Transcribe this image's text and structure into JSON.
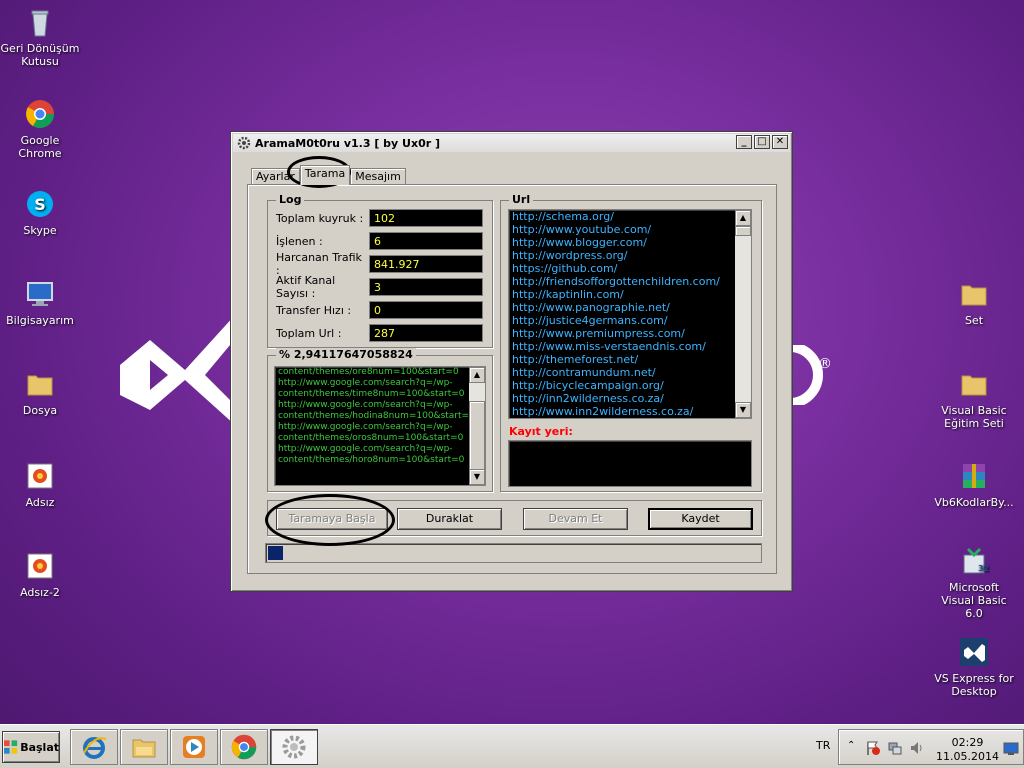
{
  "desktop": {
    "icons_left": [
      {
        "label": "Geri Dönüşüm Kutusu",
        "icon": "recycle-bin-icon"
      },
      {
        "label": "Google Chrome",
        "icon": "chrome-icon"
      },
      {
        "label": "Skype",
        "icon": "skype-icon"
      },
      {
        "label": "Bilgisayarım",
        "icon": "computer-icon"
      },
      {
        "label": "Dosya",
        "icon": "folder-icon"
      },
      {
        "label": "Adsız",
        "icon": "image-icon"
      },
      {
        "label": "Adsız-2",
        "icon": "image-icon"
      }
    ],
    "icons_right": [
      {
        "label": "Set",
        "icon": "folder-icon"
      },
      {
        "label": "Visual Basic Eğitim Seti",
        "icon": "folder-icon"
      },
      {
        "label": "Vb6KodlarBy...",
        "icon": "winrar-icon"
      },
      {
        "label": "Microsoft Visual Basic 6.0",
        "icon": "vb6-icon"
      },
      {
        "label": "VS Express for Desktop",
        "icon": "vs-icon"
      }
    ]
  },
  "window": {
    "title": "AramaM0t0ru v1.3 [ by Ux0r ]",
    "controls": {
      "minimize": "_",
      "maximize": "□",
      "close": "✕"
    },
    "tabs": [
      {
        "label": "Ayarlar",
        "active": false
      },
      {
        "label": "Tarama",
        "active": true
      },
      {
        "label": "Mesajım",
        "active": false
      }
    ],
    "log": {
      "title": "Log",
      "rows": [
        {
          "label": "Toplam kuyruk :",
          "value": "102"
        },
        {
          "label": "İşlenen :",
          "value": "6"
        },
        {
          "label": "Harcanan Trafik :",
          "value": "841.927"
        },
        {
          "label": "Aktif Kanal Sayısı :",
          "value": "3"
        },
        {
          "label": "Transfer Hızı :",
          "value": "0"
        },
        {
          "label": "Toplam Url :",
          "value": "287"
        }
      ]
    },
    "progress_group": {
      "title": "% 2,94117647058824",
      "lines": [
        "content/themes/ore8num=100&start=0",
        "http://www.google.com/search?q=/wp-",
        "content/themes/time8num=100&start=0",
        "http://www.google.com/search?q=/wp-",
        "content/themes/hodina8num=100&start=0",
        "http://www.google.com/search?q=/wp-",
        "content/themes/oros8num=100&start=0",
        "http://www.google.com/search?q=/wp-",
        "content/themes/horo8num=100&start=0"
      ]
    },
    "url_group": {
      "title": "Url",
      "urls": [
        "http://schema.org/",
        "http://www.youtube.com/",
        "http://www.blogger.com/",
        "http://wordpress.org/",
        "https://github.com/",
        "http://friendsofforgottenchildren.com/",
        "http://kaptinlin.com/",
        "http://www.panographie.net/",
        "http://justice4germans.com/",
        "http://www.premiumpress.com/",
        "http://www.miss-verstaendnis.com/",
        "http://themeforest.net/",
        "http://contramundum.net/",
        "http://bicyclecampaign.org/",
        "http://inn2wilderness.co.za/",
        "http://www.inn2wilderness.co.za/"
      ],
      "save_location_label": "Kayıt yeri:"
    },
    "buttons": {
      "start": "Taramaya Başla",
      "pause": "Duraklat",
      "resume": "Devam Et",
      "save": "Kaydet"
    },
    "progress_fraction": 0.03
  },
  "taskbar": {
    "start_label": "Başlat",
    "items": [
      "ie-icon",
      "explorer-icon",
      "media-player-icon",
      "chrome-icon",
      "app-gear-icon"
    ],
    "language": "TR",
    "time": "02:29",
    "date": "11.05.2014"
  },
  "colors": {
    "desktop_bg": "#7a2fa0",
    "log_value_fg": "#ffff40",
    "url_fg": "#3cb4ff",
    "progress_fg": "#3cc83c",
    "save_label_fg": "#ff0000",
    "progress_fill": "#0a246a"
  }
}
